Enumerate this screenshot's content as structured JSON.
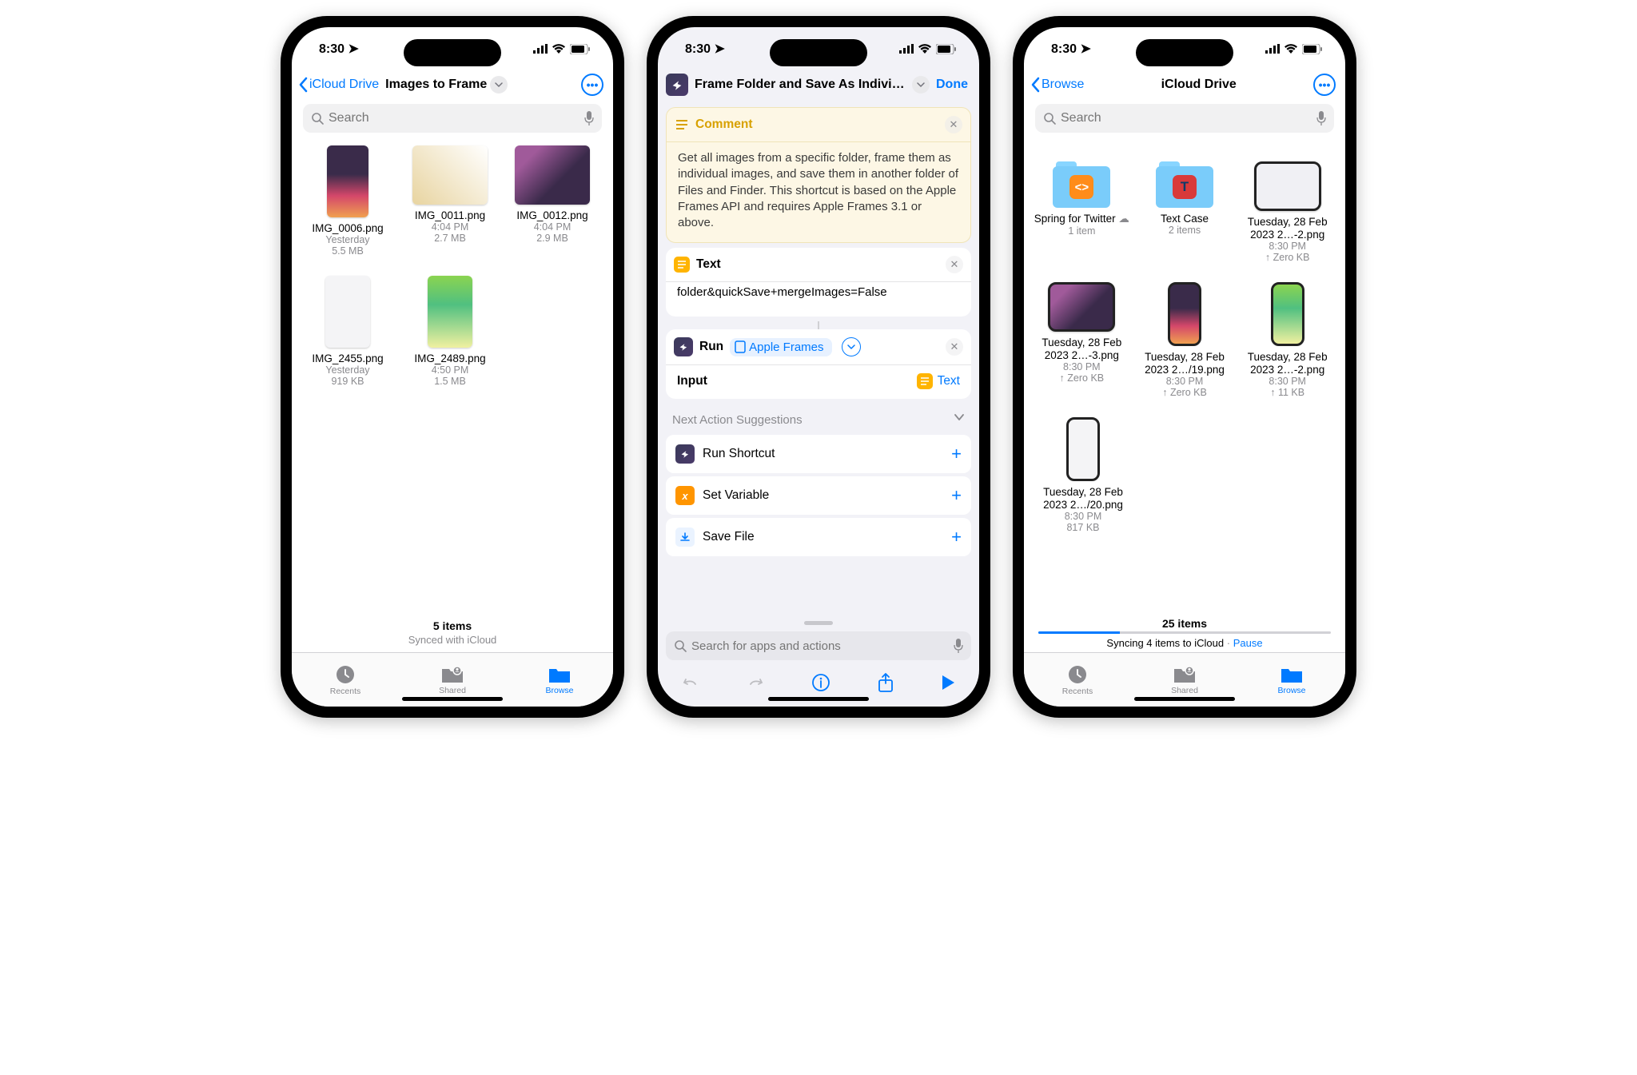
{
  "status": {
    "time": "8:30",
    "loc_arrow": "↗"
  },
  "phone1": {
    "back": "iCloud Drive",
    "title": "Images to Frame",
    "search_ph": "Search",
    "items": [
      {
        "name": "IMG_0006.png",
        "l1": "Yesterday",
        "l2": "5.5 MB"
      },
      {
        "name": "IMG_0011.png",
        "l1": "4:04 PM",
        "l2": "2.7 MB"
      },
      {
        "name": "IMG_0012.png",
        "l1": "4:04 PM",
        "l2": "2.9 MB"
      },
      {
        "name": "IMG_2455.png",
        "l1": "Yesterday",
        "l2": "919 KB"
      },
      {
        "name": "IMG_2489.png",
        "l1": "4:50 PM",
        "l2": "1.5 MB"
      }
    ],
    "count": "5 items",
    "sync": "Synced with iCloud",
    "tabs": {
      "recents": "Recents",
      "shared": "Shared",
      "browse": "Browse"
    }
  },
  "phone2": {
    "title": "Frame Folder and Save As Indivi…",
    "done": "Done",
    "comment_label": "Comment",
    "comment_body": "Get all images from a specific folder, frame them as individual images, and save them in another folder of Files and Finder. This shortcut is based on the Apple Frames API and requires Apple Frames 3.1 or above.",
    "text_label": "Text",
    "text_body": "folder&quickSave+mergeImages=False",
    "run_label": "Run",
    "run_pill": "Apple Frames",
    "input_label": "Input",
    "input_pill": "Text",
    "sugg_label": "Next Action Suggestions",
    "sugg": [
      {
        "label": "Run Shortcut",
        "bg": "linear-gradient(135deg,#3a3a5a,#4a3a6a)"
      },
      {
        "label": "Set Variable",
        "bg": "#ff9500"
      },
      {
        "label": "Save File",
        "bg": "#e7f1ff"
      }
    ],
    "search_ph": "Search for apps and actions"
  },
  "phone3": {
    "back": "Browse",
    "title": "iCloud Drive",
    "search_ph": "Search",
    "row1": [
      {
        "name": "Spring for Twitter",
        "l1": "1 item",
        "type": "folder-orange"
      },
      {
        "name": "Text Case",
        "l1": "2 items",
        "type": "folder-red"
      },
      {
        "name": "Tuesday, 28 Feb 2023 2…-2.png",
        "l1": "8:30 PM",
        "l2": "↑ Zero KB",
        "type": "img-wide"
      }
    ],
    "row2": [
      {
        "name": "Tuesday, 28 Feb 2023 2…-3.png",
        "l1": "8:30 PM",
        "l2": "↑ Zero KB"
      },
      {
        "name": "Tuesday, 28 Feb 2023 2…/19.png",
        "l1": "8:30 PM",
        "l2": "↑ Zero KB"
      },
      {
        "name": "Tuesday, 28 Feb 2023 2…-2.png",
        "l1": "8:30 PM",
        "l2": "↑ 11 KB"
      }
    ],
    "row3": [
      {
        "name": "Tuesday, 28 Feb 2023 2…/20.png",
        "l1": "8:30 PM",
        "l2": "817 KB"
      }
    ],
    "count": "25 items",
    "sync": "Syncing 4 items to iCloud",
    "pause": "Pause",
    "tabs": {
      "recents": "Recents",
      "shared": "Shared",
      "browse": "Browse"
    }
  }
}
